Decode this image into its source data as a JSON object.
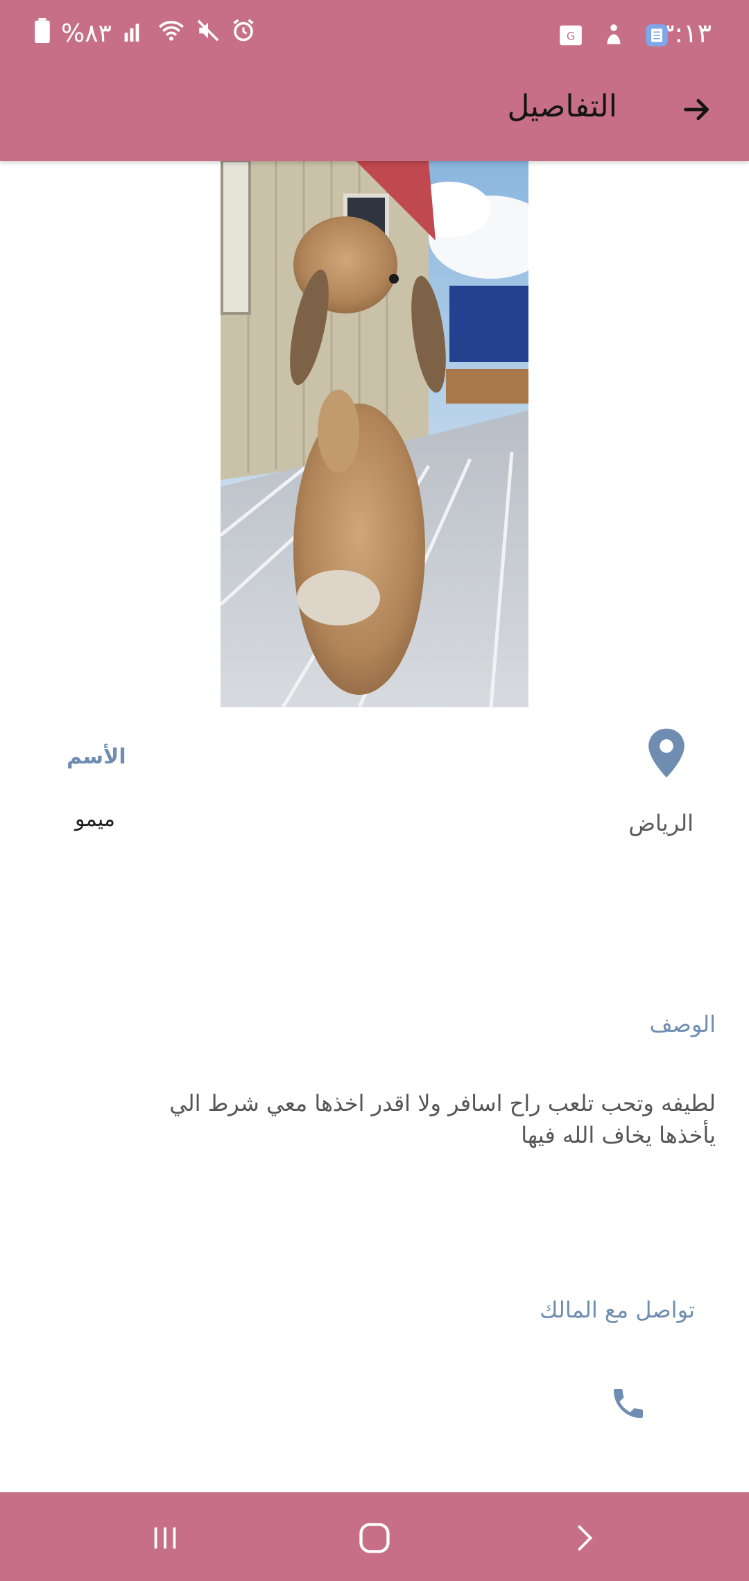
{
  "status_bar": {
    "time": "٣:١٣",
    "battery": "%٨٣"
  },
  "appbar": {
    "title": "التفاصيل"
  },
  "pet": {
    "location": "الرياض",
    "name_label": "الأسم",
    "name_value": "ميمو",
    "description_label": "الوصف",
    "description": "لطيفه وتحب تلعب راح اسافر ولا اقدر اخذها معي شرط الي يأخذها يخاف الله فيها",
    "contact_label": "تواصل مع المالك"
  },
  "colors": {
    "primary": "#c66f87",
    "accent_text": "#6f8db1"
  }
}
